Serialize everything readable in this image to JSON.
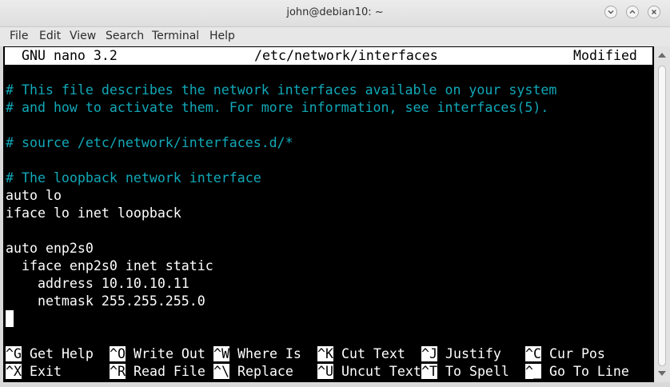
{
  "window": {
    "title": "john@debian10: ~",
    "controls": [
      "chevron-down-icon",
      "chevron-up-icon",
      "close-icon"
    ]
  },
  "menubar": {
    "items": [
      {
        "label": "File"
      },
      {
        "label": "Edit"
      },
      {
        "label": "View"
      },
      {
        "label": "Search"
      },
      {
        "label": "Terminal"
      },
      {
        "label": "Help"
      }
    ]
  },
  "nano": {
    "version": "GNU nano 3.2",
    "filename": "/etc/network/interfaces",
    "status": "Modified",
    "lines": [
      {
        "text": "# This file describes the network interfaces available on your system",
        "type": "comment"
      },
      {
        "text": "# and how to activate them. For more information, see interfaces(5).",
        "type": "comment"
      },
      {
        "text": "",
        "type": "text"
      },
      {
        "text": "# source /etc/network/interfaces.d/*",
        "type": "comment"
      },
      {
        "text": "",
        "type": "text"
      },
      {
        "text": "# The loopback network interface",
        "type": "comment"
      },
      {
        "text": "auto lo",
        "type": "text"
      },
      {
        "text": "iface lo inet loopback",
        "type": "text"
      },
      {
        "text": "",
        "type": "text"
      },
      {
        "text": "auto enp2s0",
        "type": "text"
      },
      {
        "text": "  iface enp2s0 inet static",
        "type": "text"
      },
      {
        "text": "    address 10.10.10.11",
        "type": "text"
      },
      {
        "text": "    netmask 255.255.255.0",
        "type": "text"
      }
    ],
    "shortcuts_row1": [
      {
        "key": "^G",
        "label": "Get Help"
      },
      {
        "key": "^O",
        "label": "Write Out"
      },
      {
        "key": "^W",
        "label": "Where Is"
      },
      {
        "key": "^K",
        "label": "Cut Text"
      },
      {
        "key": "^J",
        "label": "Justify"
      },
      {
        "key": "^C",
        "label": "Cur Pos"
      }
    ],
    "shortcuts_row2": [
      {
        "key": "^X",
        "label": "Exit"
      },
      {
        "key": "^R",
        "label": "Read File"
      },
      {
        "key": "^\\",
        "label": "Replace"
      },
      {
        "key": "^U",
        "label": "Uncut Text"
      },
      {
        "key": "^T",
        "label": "To Spell"
      },
      {
        "key": "^_",
        "label": "Go To Line"
      }
    ]
  },
  "colors": {
    "comment": "#11a8b8",
    "terminal_bg": "#000000",
    "terminal_fg": "#ffffff"
  }
}
